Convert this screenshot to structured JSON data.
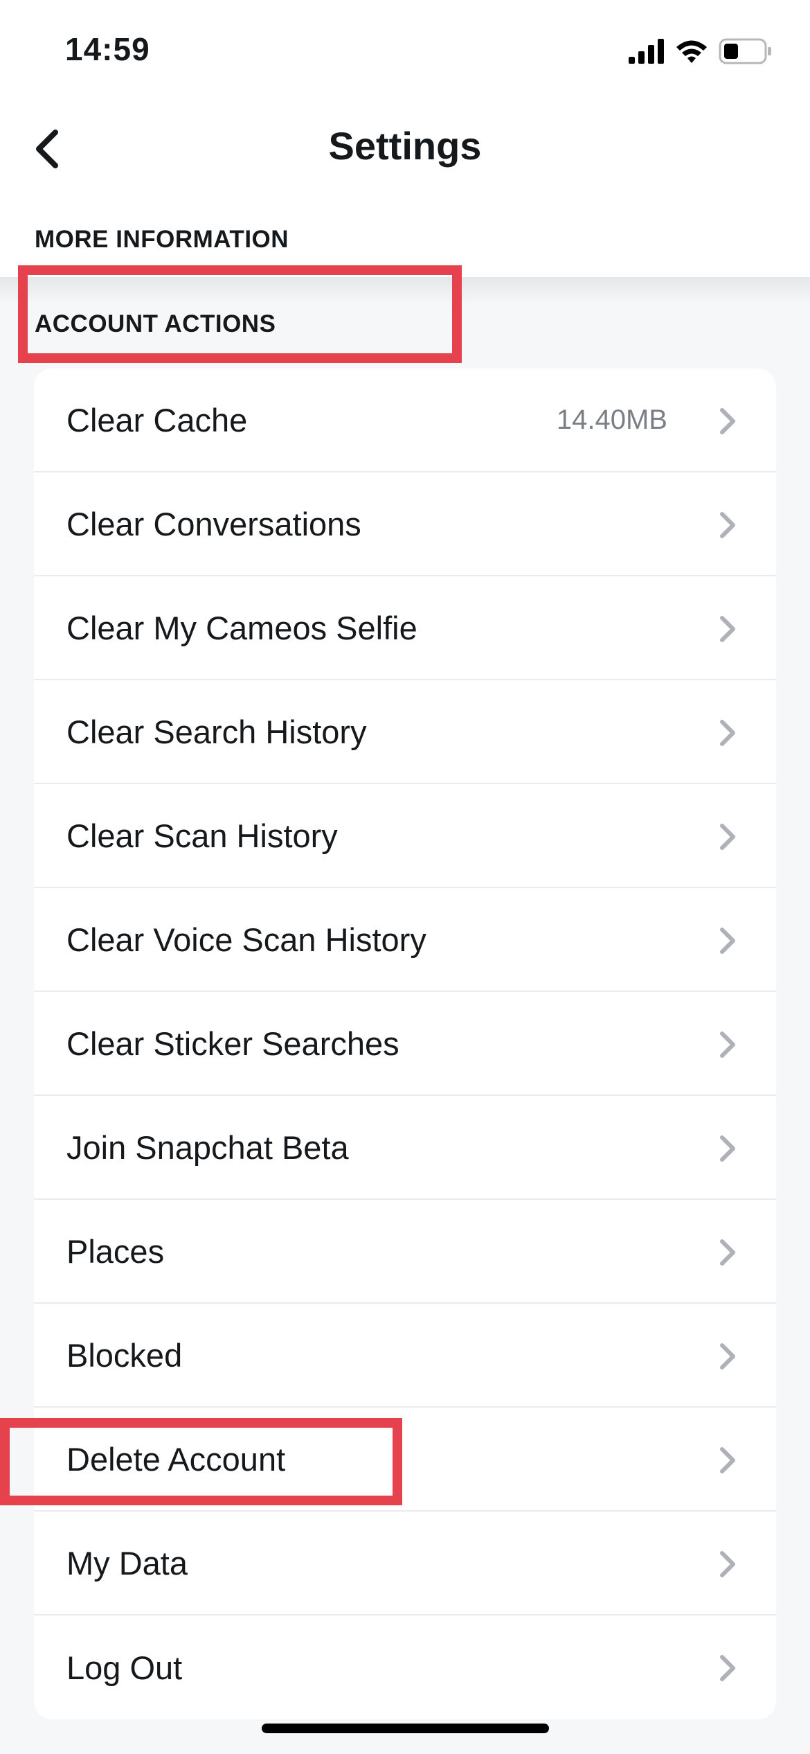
{
  "status_bar": {
    "time": "14:59",
    "icons": [
      "signal-icon",
      "wifi-icon",
      "battery-icon"
    ]
  },
  "nav": {
    "back_icon": "chevron-left-icon",
    "title": "Settings"
  },
  "sections": {
    "more_information": "MORE INFORMATION",
    "account_actions": "ACCOUNT ACTIONS"
  },
  "rows": [
    {
      "label": "Clear Cache",
      "value": "14.40MB"
    },
    {
      "label": "Clear Conversations"
    },
    {
      "label": "Clear My Cameos Selfie"
    },
    {
      "label": "Clear Search History"
    },
    {
      "label": "Clear Scan History"
    },
    {
      "label": "Clear Voice Scan History"
    },
    {
      "label": "Clear Sticker Searches"
    },
    {
      "label": "Join Snapchat Beta"
    },
    {
      "label": "Places"
    },
    {
      "label": "Blocked"
    },
    {
      "label": "Delete Account"
    },
    {
      "label": "My Data"
    },
    {
      "label": "Log Out"
    }
  ],
  "colors": {
    "highlight": "#E5424D",
    "chevron": "#AEB2B8",
    "background": "#F6F7F8"
  }
}
